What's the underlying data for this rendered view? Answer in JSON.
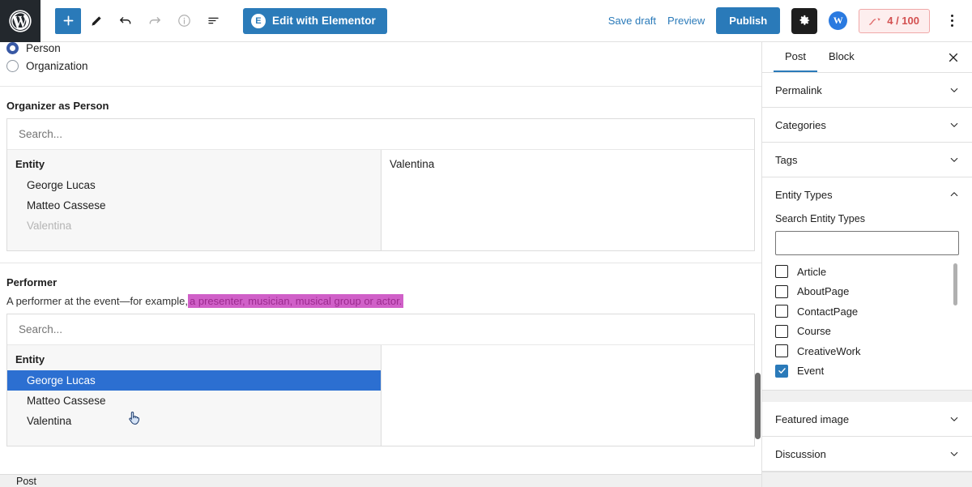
{
  "toolbar": {
    "logo_icon": "wordpress-logo-icon",
    "add_block_label": "+",
    "add_block_icon": "plus-icon",
    "edit_icon": "pencil-icon",
    "undo_icon": "undo-arrow-icon",
    "redo_icon": "redo-arrow-icon",
    "info_icon": "info-circle-icon",
    "list_view_icon": "list-view-icon",
    "elementor_label": "Edit with Elementor",
    "elementor_badge": "E",
    "save_draft_label": "Save draft",
    "preview_label": "Preview",
    "publish_label": "Publish",
    "settings_icon": "gear-icon",
    "wordlift_badge": "W",
    "seo_score": "4 / 100",
    "seo_icon": "seo-trend-icon",
    "more_icon": "kebab-menu-icon",
    "accent_color": "#2a7ab9",
    "seo_color": "#d35050"
  },
  "editor": {
    "entity_kind": {
      "options": [
        "Person",
        "Organization"
      ],
      "selected": "Person"
    },
    "organizer": {
      "label": "Organizer as Person",
      "search_placeholder": "Search...",
      "column_header": "Entity",
      "entities": [
        {
          "name": "George Lucas",
          "state": "normal"
        },
        {
          "name": "Matteo Cassese",
          "state": "normal"
        },
        {
          "name": "Valentina",
          "state": "muted"
        }
      ],
      "selected_entities": [
        "Valentina"
      ]
    },
    "performer": {
      "label": "Performer",
      "description_plain": "A performer at the event—for example,",
      "description_highlight": "a presenter, musician, musical group or actor.",
      "highlight_color": "#d060c8",
      "search_placeholder": "Search...",
      "column_header": "Entity",
      "entities": [
        {
          "name": "George Lucas",
          "state": "selected"
        },
        {
          "name": "Matteo Cassese",
          "state": "normal"
        },
        {
          "name": "Valentina",
          "state": "normal"
        }
      ],
      "selected_entities": []
    },
    "breadcrumb": "Post"
  },
  "sidebar": {
    "tabs": [
      {
        "label": "Post",
        "active": true
      },
      {
        "label": "Block",
        "active": false
      }
    ],
    "close_icon": "close-icon",
    "panels": [
      {
        "label": "Permalink",
        "expanded": false
      },
      {
        "label": "Categories",
        "expanded": false
      },
      {
        "label": "Tags",
        "expanded": false
      },
      {
        "label": "Entity Types",
        "expanded": true
      }
    ],
    "entity_types": {
      "search_label": "Search Entity Types",
      "search_value": "",
      "items": [
        {
          "label": "Article",
          "checked": false
        },
        {
          "label": "AboutPage",
          "checked": false
        },
        {
          "label": "ContactPage",
          "checked": false
        },
        {
          "label": "Course",
          "checked": false
        },
        {
          "label": "CreativeWork",
          "checked": false
        },
        {
          "label": "Event",
          "checked": true
        }
      ]
    },
    "bottom_panels": [
      {
        "label": "Featured image",
        "expanded": false
      },
      {
        "label": "Discussion",
        "expanded": false
      }
    ]
  }
}
